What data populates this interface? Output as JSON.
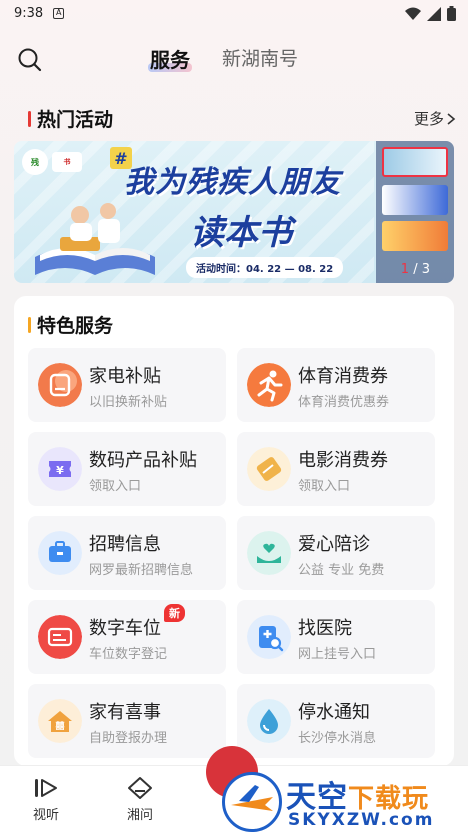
{
  "status_bar": {
    "time": "9:38",
    "notification_letter": "A"
  },
  "header": {
    "tabs": [
      {
        "label": "服务",
        "active": true
      },
      {
        "label": "新湖南号",
        "active": false
      }
    ]
  },
  "hot": {
    "title": "热门活动",
    "more": "更多",
    "banner": {
      "logo1": "残",
      "logo2": "书",
      "headline_line1": "我为残疾人朋友",
      "headline_line2": "读本书",
      "date": "活动时间：04. 22 — 08. 22",
      "counter_current": "1",
      "counter_total": "/ 3"
    }
  },
  "special": {
    "title": "特色服务",
    "items": [
      {
        "title": "家电补贴",
        "sub": "以旧换新补贴",
        "icon": "appliance-icon",
        "color": "#f27a4b"
      },
      {
        "title": "体育消费券",
        "sub": "体育消费优惠券",
        "icon": "runner-icon",
        "color": "#f57a3e"
      },
      {
        "title": "数码产品补贴",
        "sub": "领取入口",
        "icon": "yen-ticket-icon",
        "color": "#7b6cf0"
      },
      {
        "title": "电影消费券",
        "sub": "领取入口",
        "icon": "movie-ticket-icon",
        "color": "#f0b34a"
      },
      {
        "title": "招聘信息",
        "sub": "网罗最新招聘信息",
        "icon": "briefcase-icon",
        "color": "#3e8cf0"
      },
      {
        "title": "爱心陪诊",
        "sub": "公益  专业  免费",
        "icon": "caring-hands-icon",
        "color": "#2fb59a"
      },
      {
        "title": "数字车位",
        "sub": "车位数字登记",
        "icon": "parking-card-icon",
        "color": "#ef4a45",
        "badge": "新"
      },
      {
        "title": "找医院",
        "sub": "网上挂号入口",
        "icon": "hospital-search-icon",
        "color": "#3e8cf0"
      },
      {
        "title": "家有喜事",
        "sub": "自助登报办理",
        "icon": "happy-home-icon",
        "color": "#f0a23e"
      },
      {
        "title": "停水通知",
        "sub": "长沙停水消息",
        "icon": "water-drop-icon",
        "color": "#3da0d8"
      }
    ]
  },
  "bottom_nav": {
    "items": [
      {
        "label": "视听",
        "icon": "video-play-icon"
      },
      {
        "label": "湘问",
        "icon": "chat-ask-icon"
      }
    ]
  },
  "watermark": {
    "name": "天空",
    "accent": "下载玩",
    "url": "SKYXZW.com"
  }
}
